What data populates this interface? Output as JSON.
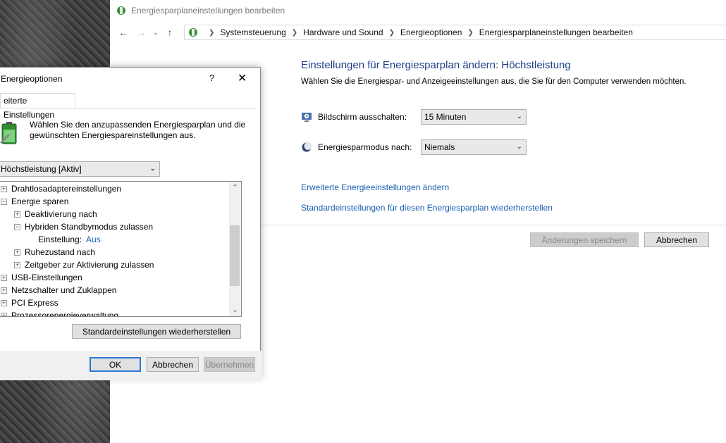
{
  "window": {
    "title": "Energiesparplaneinstellungen bearbeiten"
  },
  "address": {
    "breadcrumbs": [
      "Systemsteuerung",
      "Hardware und Sound",
      "Energieoptionen",
      "Energiesparplaneinstellungen bearbeiten"
    ]
  },
  "plan": {
    "heading": "Einstellungen für Energiesparplan ändern: Höchstleistung",
    "subtitle": "Wählen Sie die Energiespar- und Anzeigeeinstellungen aus, die Sie für den Computer verwenden möchten.",
    "display_off_label": "Bildschirm ausschalten:",
    "display_off_value": "15 Minuten",
    "sleep_label": "Energiesparmodus nach:",
    "sleep_value": "Niemals",
    "advanced_link": "Erweiterte Energieeinstellungen ändern",
    "restore_link": "Standardeinstellungen für diesen Energiesparplan wiederherstellen",
    "save_button": "Änderungen speichern",
    "cancel_button": "Abbrechen"
  },
  "dialog": {
    "title": "Energieoptionen",
    "help": "?",
    "close": "✕",
    "tab": "eiterte Einstellungen",
    "intro": "Wählen Sie den anzupassenden Energiesparplan und die gewünschten Energiespareinstellungen aus.",
    "plan_select": "Höchstleistung [Aktiv]",
    "tree": [
      {
        "label": "Drahtlosadaptereinstellungen",
        "expander": "+",
        "indent": 0
      },
      {
        "label": "Energie sparen",
        "expander": "−",
        "indent": 0
      },
      {
        "label": "Deaktivierung nach",
        "expander": "+",
        "indent": 1
      },
      {
        "label": "Hybriden Standbymodus zulassen",
        "expander": "−",
        "indent": 1
      },
      {
        "label": "Einstellung:",
        "value": "Aus",
        "indent": 2
      },
      {
        "label": "Ruhezustand nach",
        "expander": "+",
        "indent": 1
      },
      {
        "label": "Zeitgeber zur Aktivierung zulassen",
        "expander": "+",
        "indent": 1
      },
      {
        "label": "USB-Einstellungen",
        "expander": "+",
        "indent": 0
      },
      {
        "label": "Netzschalter und Zuklappen",
        "expander": "+",
        "indent": 0
      },
      {
        "label": "PCI Express",
        "expander": "+",
        "indent": 0
      },
      {
        "label": "Prozessorenergieverwaltung",
        "expander": "+",
        "indent": 0
      }
    ],
    "restore_button": "Standardeinstellungen wiederherstellen",
    "ok_button": "OK",
    "cancel_button": "Abbrechen",
    "apply_button": "Übernehmen"
  }
}
